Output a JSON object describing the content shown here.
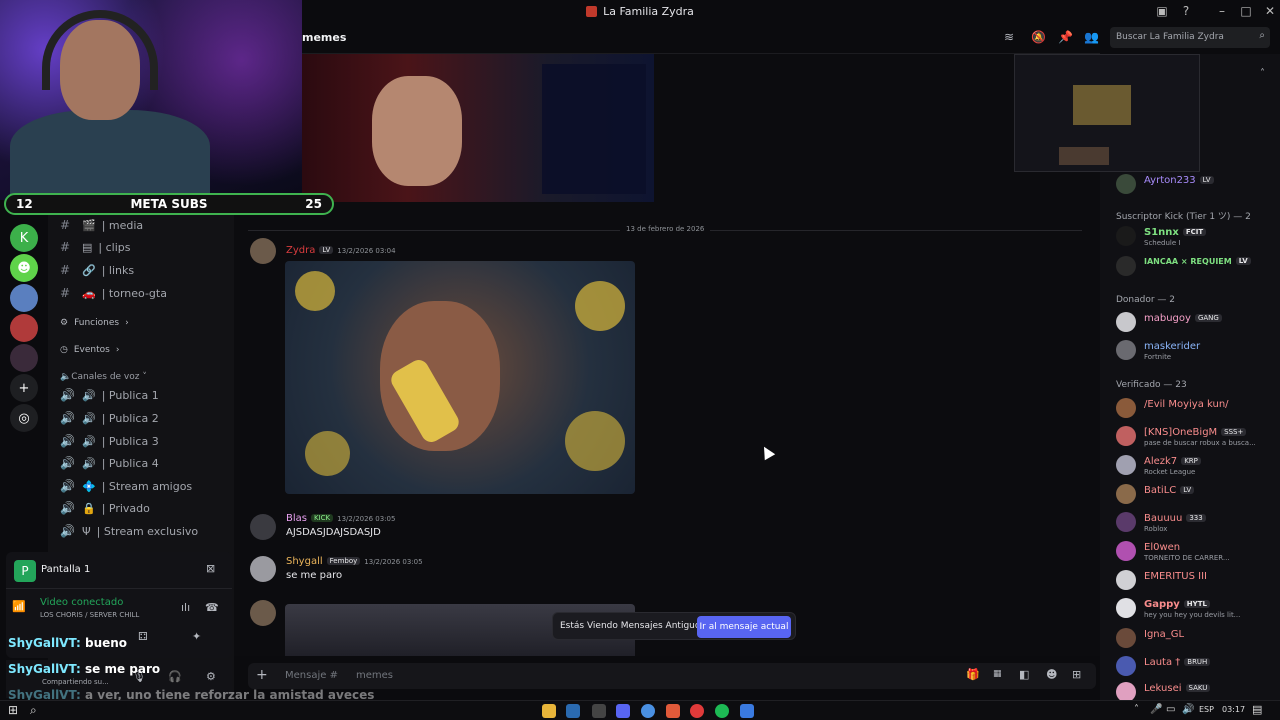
{
  "window": {
    "title": "La Familia Zydra"
  },
  "topbar": {
    "channel": "memes",
    "search_placeholder": "Buscar La Familia Zydra"
  },
  "channels": {
    "text": [
      {
        "label": "| media"
      },
      {
        "label": "| clips"
      },
      {
        "label": "| links"
      },
      {
        "label": "| torneo-gta"
      }
    ],
    "funciones": "Funciones",
    "eventos": "Eventos",
    "voice_category": "Canales de voz",
    "voice": [
      {
        "label": "| Publica 1"
      },
      {
        "label": "| Publica 2"
      },
      {
        "label": "| Publica 3"
      },
      {
        "label": "| Publica 4"
      },
      {
        "label": "| Stream amigos"
      },
      {
        "label": "| Privado"
      },
      {
        "label": "| Stream exclusivo"
      }
    ]
  },
  "chat": {
    "date_divider": "13 de febrero de 2026",
    "messages": [
      {
        "author": "Zydra",
        "badge": "LV",
        "time": "13/2/2026 03:04",
        "text": ""
      },
      {
        "author": "Blas",
        "badge": "KICK",
        "time": "13/2/2026 03:05",
        "text": "AJSDASJDAJSDASJD"
      },
      {
        "author": "Shygall",
        "badge": "Femboy",
        "time": "13/2/2026 03:05",
        "text": "se me paro"
      }
    ],
    "old_messages_notice": "Estás Viendo Mensajes Antiguos",
    "jump_button": "Ir al mensaje actual",
    "composer_placeholder": "Mensaje #",
    "composer_channel": "memes"
  },
  "voice_panel": {
    "title": "Pantalla 1",
    "status": "Video conectado",
    "server": "LOS CHORIS / SERVER CHILL",
    "sharing": "Compartiendo su..."
  },
  "stream_overlay": {
    "meta_label": "META SUBS",
    "meta_current": "12",
    "meta_goal": "25",
    "chat": [
      {
        "user": "ShyGallVT:",
        "text": "bueno"
      },
      {
        "user": "ShyGallVT:",
        "text": "se me paro"
      },
      {
        "user": "ShyGallVT:",
        "text": "a ver, uno tiene  reforzar la amistad aveces"
      }
    ]
  },
  "members": {
    "groups": [
      {
        "label": "Suscriptor Kick (Tier 1 ツ) — 2",
        "members": [
          {
            "name": "S1nnx",
            "tag": "FCIT",
            "status": "Schedule I"
          },
          {
            "name": "IANCAA × REQUIEM",
            "tag": "LV",
            "status": ""
          }
        ]
      },
      {
        "label": "Donador — 2",
        "members": [
          {
            "name": "mabugoy",
            "tag": "GANG",
            "status": ""
          },
          {
            "name": "maskerider",
            "tag": "",
            "status": "Fortnite"
          }
        ]
      },
      {
        "label": "Verificado — 23",
        "members": [
          {
            "name": "/Evil Moyiya kun/",
            "tag": "",
            "status": ""
          },
          {
            "name": "[KNS]OneBigM",
            "tag": "SSS+",
            "status": "pase de buscar robux a busca..."
          },
          {
            "name": "Alezk7",
            "tag": "KRP",
            "status": "Rocket League"
          },
          {
            "name": "BatiLC",
            "tag": "LV",
            "status": ""
          },
          {
            "name": "Bauuuu",
            "tag": "333",
            "status": "Roblox"
          },
          {
            "name": "El0wen",
            "tag": "",
            "status": "TORNEITO DE CARRER..."
          },
          {
            "name": "EMERITUS III",
            "tag": "",
            "status": ""
          },
          {
            "name": "Gappy",
            "tag": "HYTL",
            "status": "hey you hey you devils lit..."
          },
          {
            "name": "Igna_GL",
            "tag": "",
            "status": ""
          },
          {
            "name": "Lauta †",
            "tag": "BRUH",
            "status": ""
          },
          {
            "name": "Lekusei",
            "tag": "SAKU",
            "status": ""
          }
        ]
      }
    ],
    "prev_member": {
      "name": "Ayrton233",
      "tag": "LV"
    }
  },
  "taskbar": {
    "lang": "ESP",
    "time": "03:17"
  }
}
